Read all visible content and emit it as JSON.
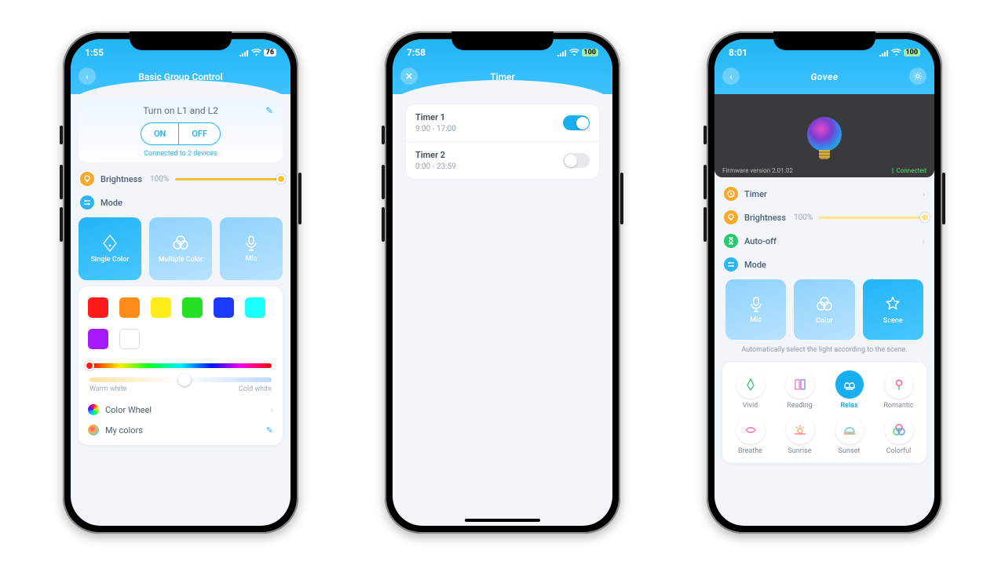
{
  "phone1": {
    "status": {
      "time": "1:55",
      "battery": "76"
    },
    "header_title": "Basic Group Control",
    "group": {
      "title": "Turn on L1 and L2",
      "on_label": "ON",
      "off_label": "OFF",
      "connected": "Connected to 2 devices"
    },
    "brightness": {
      "label": "Brightness",
      "value": "100%"
    },
    "mode_label": "Mode",
    "modes": {
      "single": "Single Color",
      "multiple": "Multiple Color",
      "mic": "Mic"
    },
    "swatch_colors": [
      "#ff1a1a",
      "#ff8c1a",
      "#ffeb1a",
      "#26e026",
      "#1a3bff",
      "#1affff",
      "#a61aff",
      "#ffffff"
    ],
    "temp": {
      "warm": "Warm white",
      "cold": "Cold white"
    },
    "rows": {
      "color_wheel": "Color Wheel",
      "my_colors": "My colors"
    }
  },
  "phone2": {
    "status": {
      "time": "7:58",
      "battery": "100"
    },
    "header_title": "Timer",
    "timers": [
      {
        "name": "Timer 1",
        "range": "9:00 - 17:00",
        "on": true
      },
      {
        "name": "Timer 2",
        "range": "0:00 - 23:59",
        "on": false
      }
    ]
  },
  "phone3": {
    "status": {
      "time": "8:01",
      "battery": "100"
    },
    "header_title": "Govee",
    "device": {
      "firmware": "Firmware version 2.01.02",
      "conn": "Connected"
    },
    "rows": {
      "timer": "Timer",
      "brightness": "Brightness",
      "brightness_val": "100%",
      "auto_off": "Auto-off",
      "mode": "Mode"
    },
    "modes": {
      "mic": "Mic",
      "color": "Color",
      "scene": "Scene"
    },
    "hint": "Automatically select the light according to the scene.",
    "scenes": [
      "Vivid",
      "Reading",
      "Relax",
      "Romantic",
      "Breathe",
      "Sunrise",
      "Sunset",
      "Colorful"
    ],
    "scene_active": 2
  }
}
